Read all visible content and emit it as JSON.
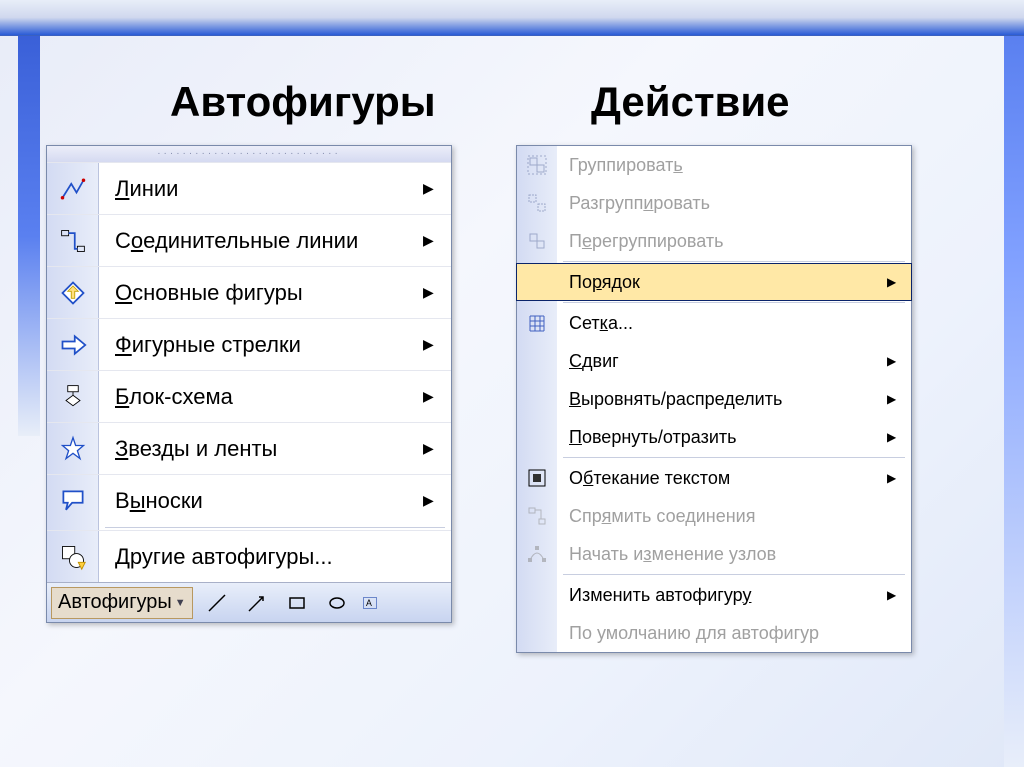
{
  "headings": {
    "left": "Автофигуры",
    "right": "Действие"
  },
  "left_menu": {
    "grip": "·····························",
    "items": [
      {
        "pre": "",
        "u": "Л",
        "post": "инии"
      },
      {
        "pre": "С",
        "u": "о",
        "post": "единительные линии"
      },
      {
        "pre": "",
        "u": "О",
        "post": "сновные фигуры"
      },
      {
        "pre": "",
        "u": "Ф",
        "post": "игурные стрелки"
      },
      {
        "pre": "",
        "u": "Б",
        "post": "лок-схема"
      },
      {
        "pre": "",
        "u": "З",
        "post": "везды и ленты"
      },
      {
        "pre": "В",
        "u": "ы",
        "post": "носки"
      }
    ],
    "more": {
      "pre": "",
      "u": "Д",
      "post": "ругие автофигуры..."
    },
    "toolbar_label": "Автофигуры"
  },
  "right_menu": {
    "items": [
      {
        "text_pre": "Группироват",
        "u": "ь",
        "text_post": "",
        "arrow": false,
        "disabled": true,
        "sep_after": false
      },
      {
        "text_pre": "Разгрупп",
        "u": "и",
        "text_post": "ровать",
        "arrow": false,
        "disabled": true,
        "sep_after": false
      },
      {
        "text_pre": "П",
        "u": "е",
        "text_post": "регруппировать",
        "arrow": false,
        "disabled": true,
        "sep_after": true
      },
      {
        "text_pre": "По",
        "u": "р",
        "text_post": "ядок",
        "arrow": true,
        "disabled": false,
        "highlight": true,
        "sep_after": true
      },
      {
        "text_pre": "Сет",
        "u": "к",
        "text_post": "а...",
        "arrow": false,
        "disabled": false,
        "sep_after": false
      },
      {
        "text_pre": "",
        "u": "С",
        "text_post": "двиг",
        "arrow": true,
        "disabled": false,
        "sep_after": false
      },
      {
        "text_pre": "",
        "u": "В",
        "text_post": "ыровнять/распределить",
        "arrow": true,
        "disabled": false,
        "sep_after": false
      },
      {
        "text_pre": "",
        "u": "П",
        "text_post": "овернуть/отразить",
        "arrow": true,
        "disabled": false,
        "sep_after": true
      },
      {
        "text_pre": "О",
        "u": "б",
        "text_post": "текание текстом",
        "arrow": true,
        "disabled": false,
        "sep_after": false
      },
      {
        "text_pre": "Спр",
        "u": "я",
        "text_post": "мить соединения",
        "arrow": false,
        "disabled": true,
        "sep_after": false
      },
      {
        "text_pre": "Начать и",
        "u": "з",
        "text_post": "менение узлов",
        "arrow": false,
        "disabled": true,
        "sep_after": true
      },
      {
        "text_pre": "Изменить автофигур",
        "u": "у",
        "text_post": "",
        "arrow": true,
        "disabled": false,
        "sep_after": false
      },
      {
        "text_pre": "По умолчанию для автофигур",
        "u": "",
        "text_post": "",
        "arrow": false,
        "disabled": true,
        "sep_after": false
      }
    ]
  }
}
